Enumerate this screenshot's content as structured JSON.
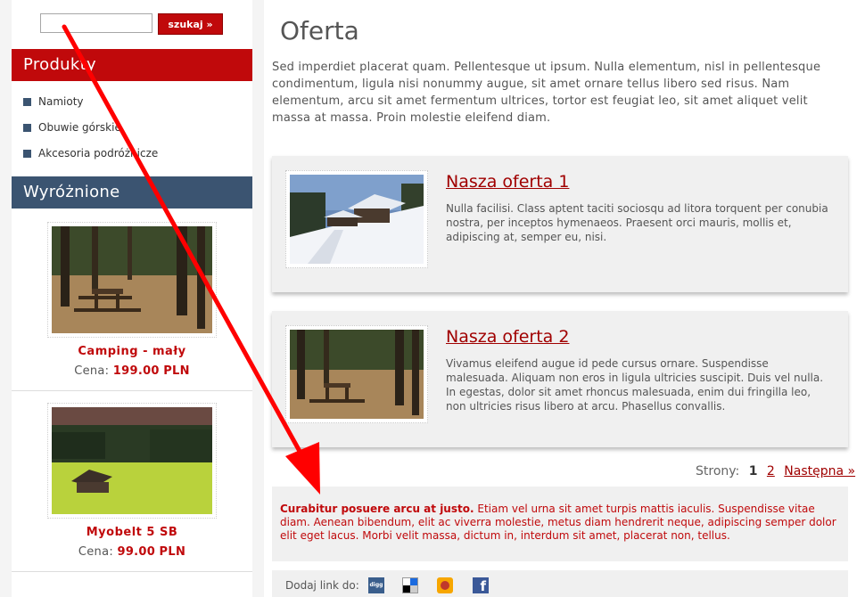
{
  "search": {
    "placeholder": "",
    "button_label": "szukaj »"
  },
  "sidebar": {
    "products_heading": "Produkty",
    "categories": [
      "Namioty",
      "Obuwie górskie",
      "Akcesoria podróżnicze"
    ],
    "featured_heading": "Wyróżnione",
    "featured": [
      {
        "name": "Camping - mały",
        "price_label": "Cena:",
        "price": "199.00",
        "currency": "PLN"
      },
      {
        "name": "Myobelt 5 SB",
        "price_label": "Cena:",
        "price": "99.00",
        "currency": "PLN"
      }
    ]
  },
  "main": {
    "title": "Oferta",
    "intro": "Sed imperdiet placerat quam. Pellentesque ut ipsum. Nulla elementum, nisl in pellentesque condimentum, ligula nisi nonummy augue, sit amet ornare tellus libero sed risus. Nam elementum, arcu sit amet fermentum ultrices, tortor est feugiat leo, sit amet aliquet velit massa at massa. Proin molestie eleifend diam.",
    "offers": [
      {
        "title": "Nasza oferta 1",
        "description": "Nulla facilisi. Class aptent taciti sociosqu ad litora torquent per conubia nostra, per inceptos hymenaeos. Praesent orci mauris, mollis et, adipiscing at, semper eu, nisi."
      },
      {
        "title": "Nasza oferta 2",
        "description": "Vivamus eleifend augue id pede cursus ornare. Suspendisse malesuada. Aliquam non eros in ligula ultricies suscipit. Duis vel nulla. In egestas, dolor sit amet rhoncus malesuada, enim dui fringilla leo, non ultricies risus libero at arcu. Phasellus convallis."
      }
    ],
    "pager": {
      "label": "Strony:",
      "current": "1",
      "page2": "2",
      "next": "Następna »"
    },
    "note": {
      "bold": "Curabitur posuere arcu at justo.",
      "text": " Etiam vel urna sit amet turpis mattis iaculis. Suspendisse vitae diam. Aenean bibendum, elit ac viverra molestie, metus diam hendrerit neque, adipiscing semper dolor elit eget lacus. Morbi velit massa, dictum in, interdum sit amet, placerat non, tellus."
    },
    "share": {
      "label": "Dodaj link do:",
      "icons": [
        "digg-icon",
        "delicious-icon",
        "wykop-icon",
        "facebook-icon"
      ],
      "digg_text": "digg",
      "facebook_text": "f"
    }
  },
  "colors": {
    "accent": "#c0090b",
    "navy": "#3b5471",
    "link": "#a00000",
    "panel": "#f0f0f0",
    "annotation_arrow": "#ff0000"
  }
}
